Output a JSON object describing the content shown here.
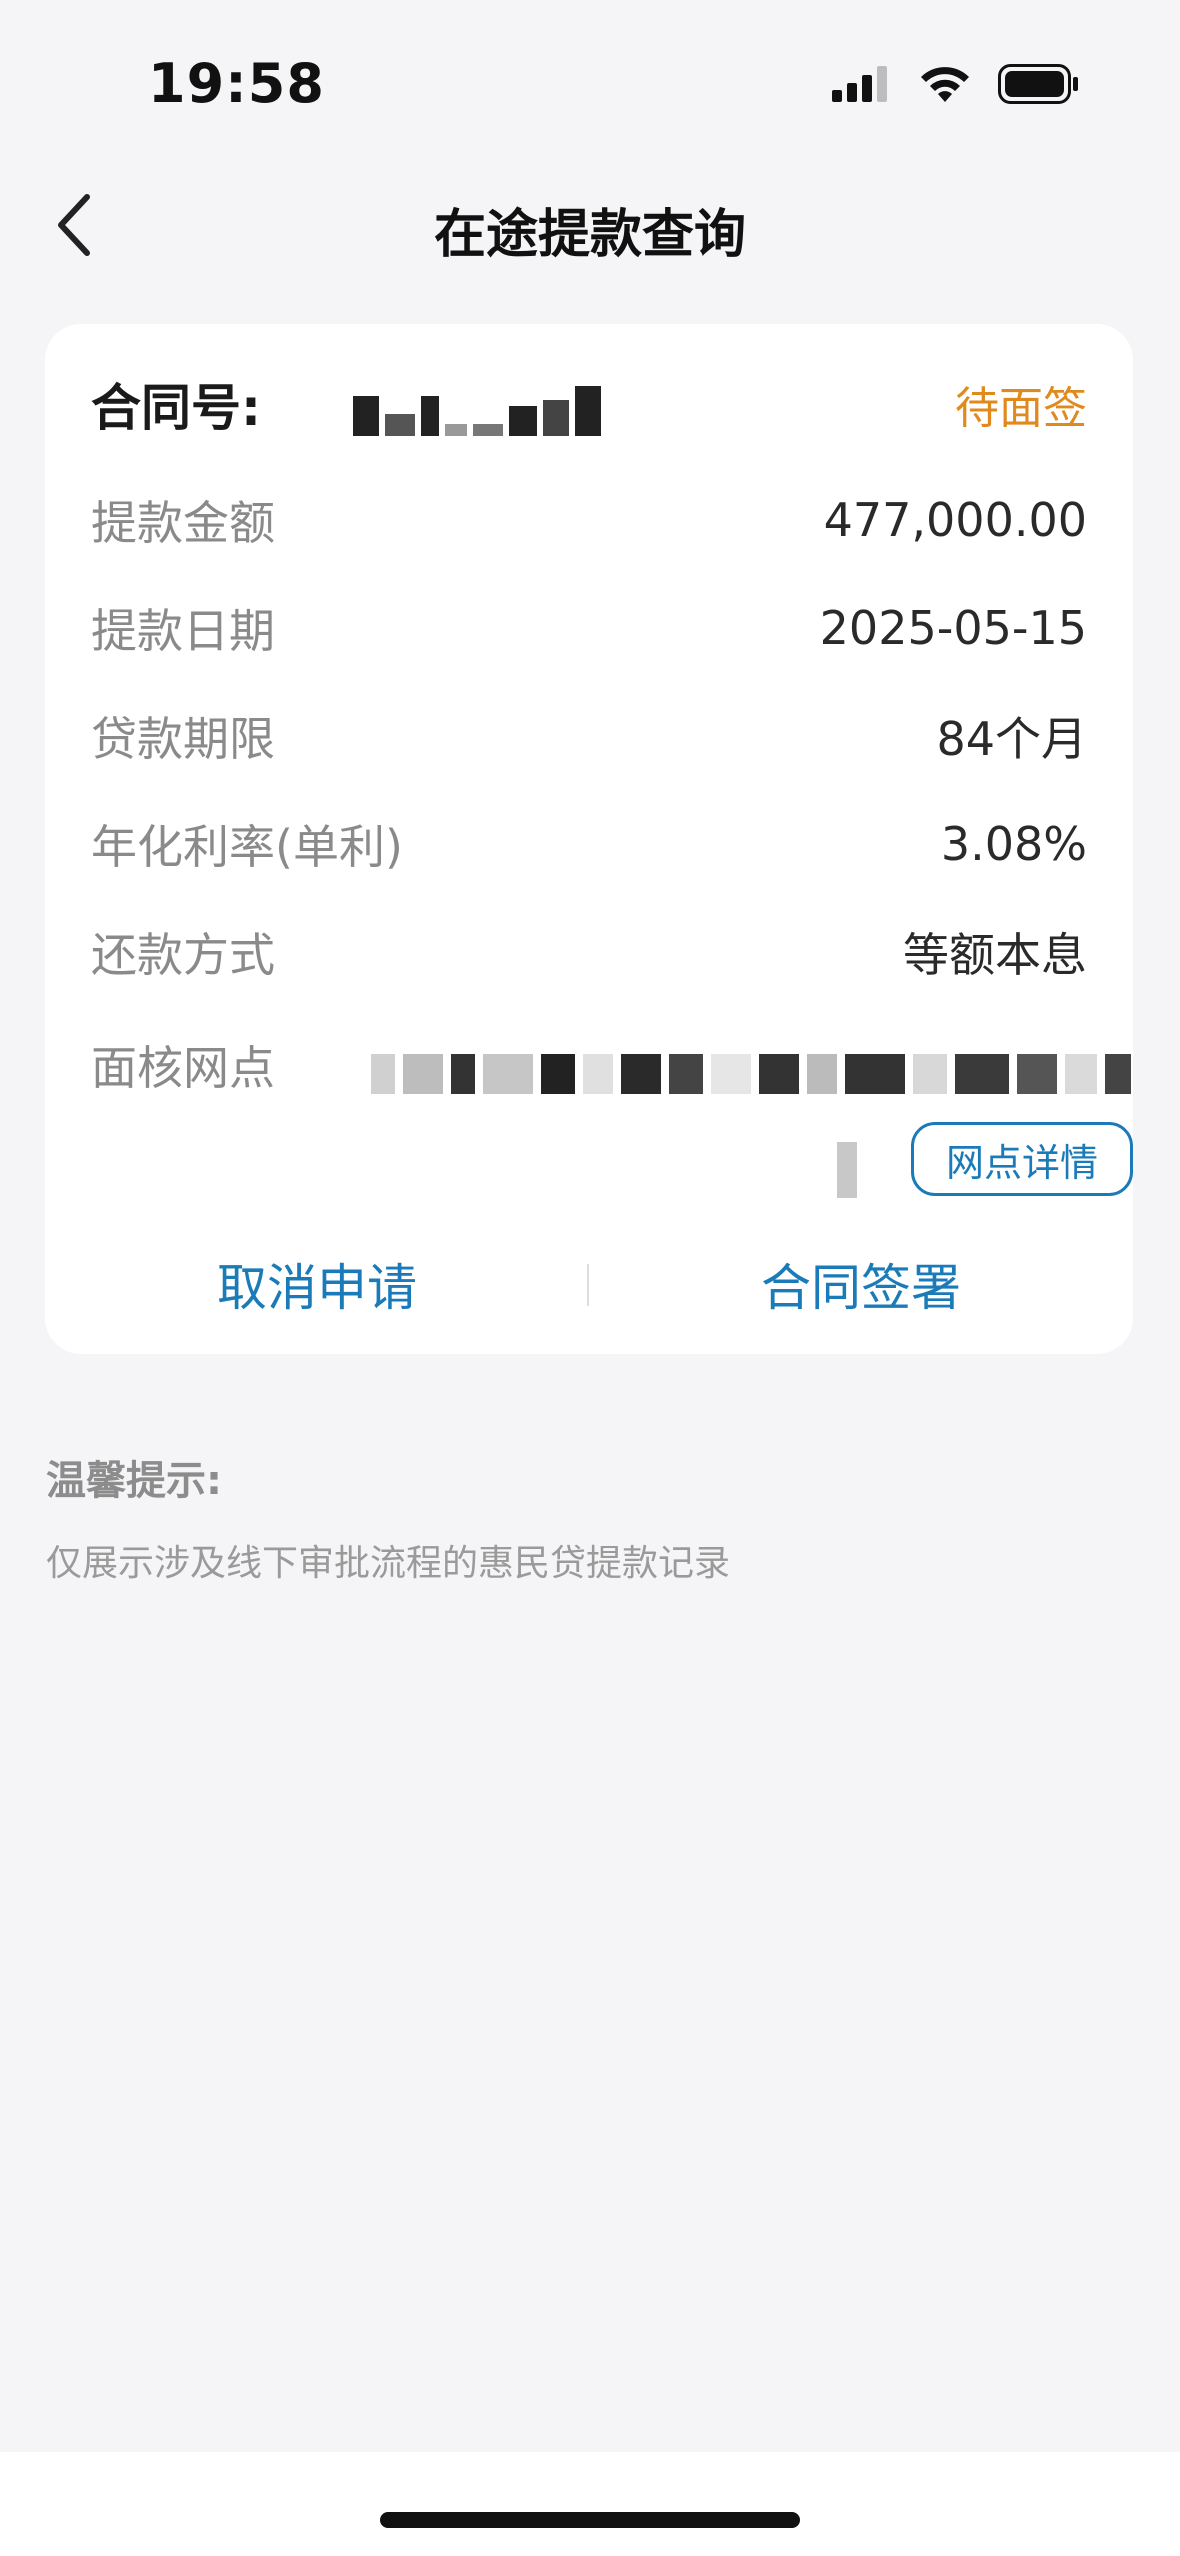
{
  "status_bar": {
    "time": "19:58",
    "icons": [
      "cellular-signal-icon",
      "wifi-icon",
      "battery-icon"
    ]
  },
  "nav": {
    "title": "在途提款查询",
    "back_icon": "chevron-left-icon"
  },
  "card": {
    "contract_label": "合同号:",
    "status": "待面签",
    "rows": [
      {
        "label": "提款金额",
        "value": "477,000.00"
      },
      {
        "label": "提款日期",
        "value": "2025-05-15"
      },
      {
        "label": "贷款期限",
        "value": "84个月"
      },
      {
        "label": "年化利率(单利)",
        "value": "3.08%"
      },
      {
        "label": "还款方式",
        "value": "等额本息"
      }
    ],
    "branch_label": "面核网点",
    "branch_detail_label": "网点详情",
    "actions": {
      "cancel_label": "取消申请",
      "sign_label": "合同签署"
    }
  },
  "tips": {
    "title": "温馨提示:",
    "text": "仅展示涉及线下审批流程的惠民贷提款记录"
  },
  "colors": {
    "accent": "#1a7bb8",
    "status_pending": "#e08a1e",
    "background": "#f5f5f7"
  }
}
